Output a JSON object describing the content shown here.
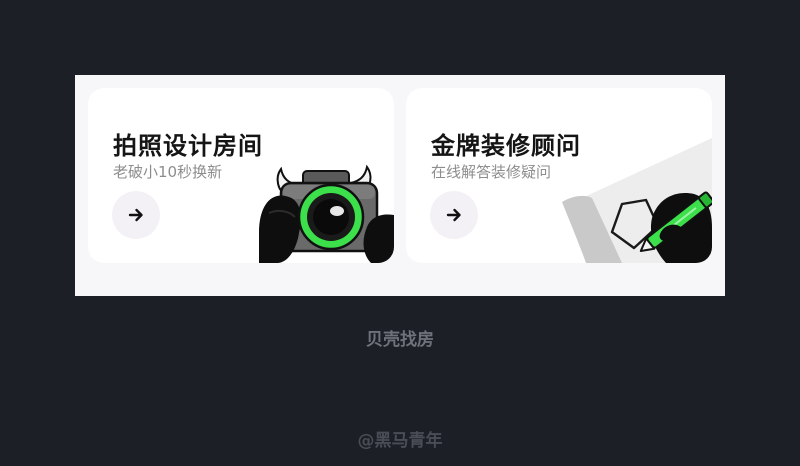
{
  "cards": [
    {
      "title": "拍照设计房间",
      "subtitle": "老破小10秒换新",
      "button_icon": "arrow-right-icon",
      "illustration": "camera-icon"
    },
    {
      "title": "金牌装修顾问",
      "subtitle": "在线解答装修疑问",
      "button_icon": "arrow-right-icon",
      "illustration": "pen-drawing-icon"
    }
  ],
  "caption": "贝壳找房",
  "watermark": "@黑马青年",
  "colors": {
    "background": "#1c1f26",
    "panel": "#f7f6f8",
    "card": "#ffffff",
    "accent_green": "#3be04a"
  }
}
